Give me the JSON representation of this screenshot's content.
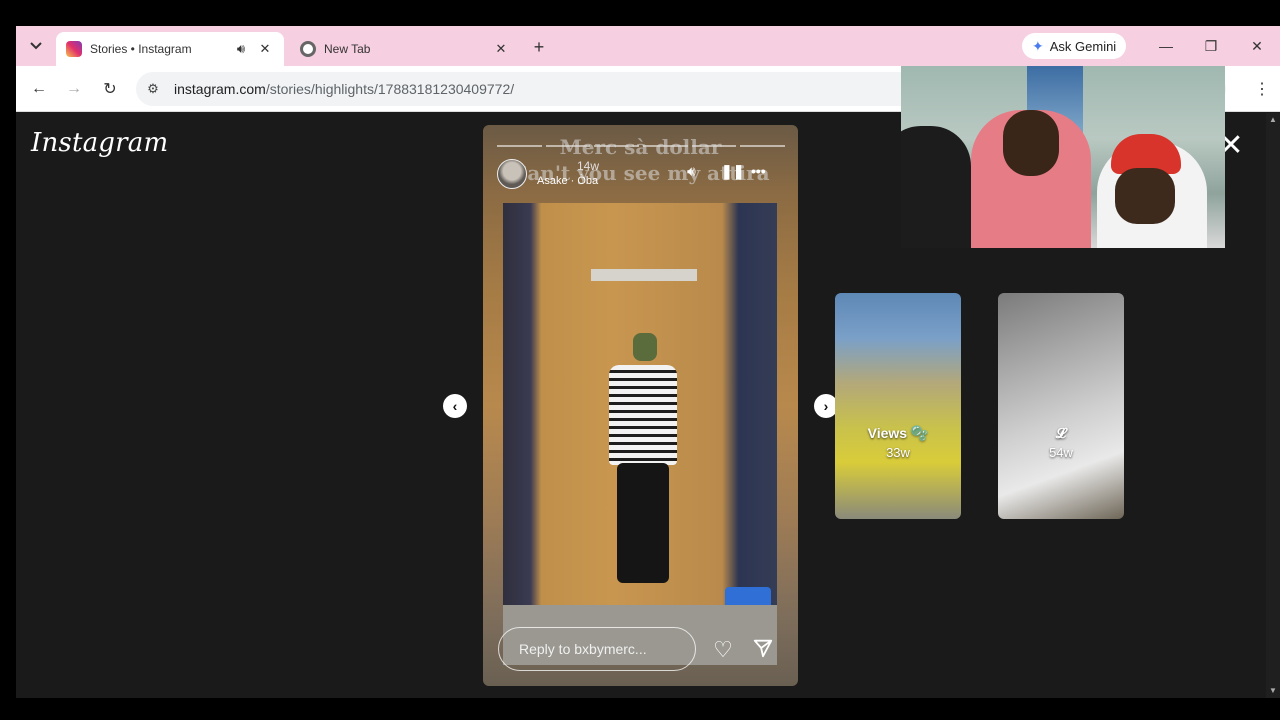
{
  "browser": {
    "tabs": [
      {
        "title": "Stories • Instagram",
        "icon": "instagram-icon",
        "audio_icon": "speaker-icon",
        "close": "✕"
      },
      {
        "title": "New Tab",
        "icon": "chrome-icon",
        "close": "✕"
      }
    ],
    "new_tab": "+",
    "gemini_label": "Ask Gemini",
    "window_controls": {
      "minimize": "—",
      "restore": "❐",
      "close": "✕"
    },
    "nav": {
      "back": "←",
      "forward": "→",
      "reload": "↻"
    },
    "url_host": "instagram.com",
    "url_path": "/stories/highlights/17883181230409772/",
    "menu": "⋮"
  },
  "page": {
    "logo": "Instagram",
    "close": "✕",
    "story": {
      "username": "",
      "age": "14w",
      "music": "Asake · Òba",
      "caption_line1": "Merc sà dollar",
      "caption_line2": "Can't you see my attira",
      "reply_placeholder": "Reply to bxbymerc...",
      "icons": [
        "mute-icon",
        "pause-icon",
        "more-icon",
        "heart-icon",
        "send-icon"
      ]
    },
    "prev_arrow": "‹",
    "next_arrow": "›",
    "thumbnails": [
      {
        "title": "Views 🫧",
        "age": "33w"
      },
      {
        "title": "𝓛",
        "age": "54w"
      }
    ]
  }
}
